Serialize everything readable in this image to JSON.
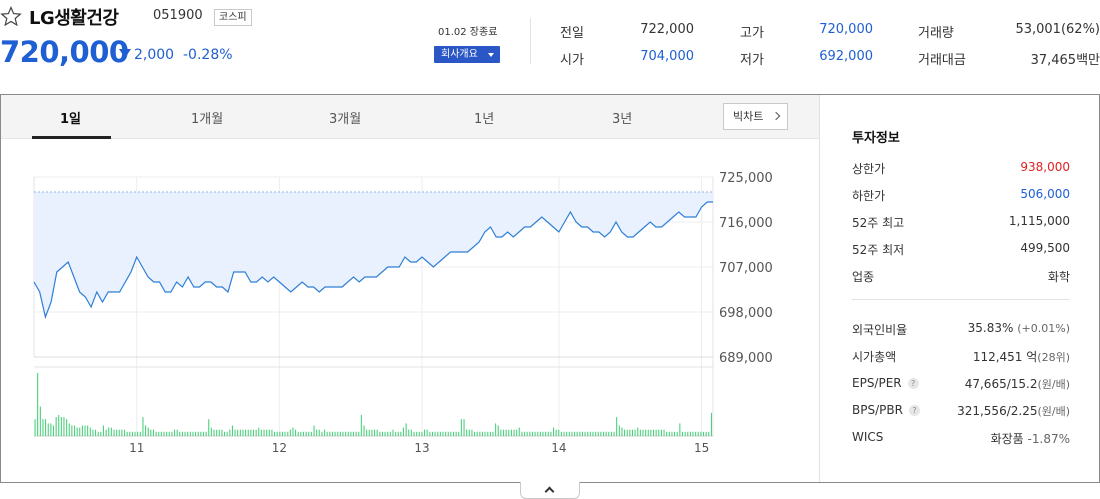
{
  "stock": {
    "name": "LG생활건강",
    "code": "051900",
    "market": "코스피",
    "price": "720,000",
    "change": "2,000",
    "change_pct": "-0.28%",
    "closed_label": "01.02 장종료",
    "company_button": "회사개요"
  },
  "summary": [
    {
      "label": "전일",
      "value": "722,000",
      "color": "#333333"
    },
    {
      "label": "고가",
      "value": "720,000",
      "color": "#1e5fd3"
    },
    {
      "label": "거래량",
      "value": "53,001(62%)",
      "color": "#333333"
    },
    {
      "label": "시가",
      "value": "704,000",
      "color": "#1e5fd3"
    },
    {
      "label": "저가",
      "value": "692,000",
      "color": "#1e5fd3"
    },
    {
      "label": "거래대금",
      "value": "37,465백만",
      "color": "#333333"
    }
  ],
  "tabs": [
    "1일",
    "1개월",
    "3개월",
    "1년",
    "3년"
  ],
  "bigchart_label": "빅차트",
  "chart_data": {
    "type": "line",
    "y_ticks": [
      "725,000",
      "716,000",
      "707,000",
      "698,000",
      "689,000"
    ],
    "y_tick_values": [
      725000,
      716000,
      707000,
      698000,
      689000
    ],
    "ylim": [
      689000,
      725000
    ],
    "prev_close": 722000,
    "x_ticks": [
      "11",
      "12",
      "13",
      "14",
      "15"
    ],
    "x_tick_index": [
      18,
      43,
      68,
      92,
      117
    ],
    "prices": [
      704000,
      702000,
      697000,
      700000,
      706000,
      707000,
      708000,
      705000,
      702000,
      701000,
      699000,
      702000,
      700000,
      702000,
      702000,
      702000,
      704000,
      706000,
      709000,
      707000,
      705000,
      704000,
      704000,
      702000,
      702000,
      704000,
      703000,
      705000,
      703000,
      703000,
      704000,
      704000,
      703000,
      703000,
      702000,
      706000,
      706000,
      706000,
      704000,
      704000,
      705000,
      704000,
      705000,
      704000,
      703000,
      702000,
      703000,
      704000,
      703000,
      703000,
      702000,
      703000,
      703000,
      703000,
      703000,
      704000,
      705000,
      704000,
      705000,
      705000,
      705000,
      706000,
      707000,
      707000,
      707000,
      709000,
      708000,
      708000,
      709000,
      708000,
      707000,
      708000,
      709000,
      710000,
      710000,
      710000,
      710000,
      711000,
      712000,
      714000,
      715000,
      713000,
      713000,
      714000,
      713000,
      714000,
      715000,
      715000,
      716000,
      717000,
      716000,
      715000,
      714000,
      716000,
      718000,
      716000,
      715000,
      715000,
      714000,
      714000,
      713000,
      714000,
      716000,
      714000,
      713000,
      713000,
      714000,
      715000,
      716000,
      715000,
      715000,
      716000,
      717000,
      718000,
      717000,
      717000,
      717000,
      719000,
      720000,
      720000
    ],
    "volumes": [
      8,
      30,
      14,
      8,
      8,
      6,
      6,
      5,
      9,
      10,
      9,
      9,
      8,
      6,
      5,
      5,
      4,
      4,
      5,
      5,
      5,
      4,
      3,
      3,
      2,
      2,
      5,
      3,
      4,
      4,
      3,
      3,
      3,
      3,
      3,
      2,
      2,
      2,
      2,
      2,
      2,
      9,
      5,
      4,
      3,
      3,
      2,
      2,
      2,
      2,
      2,
      2,
      2,
      3,
      3,
      2,
      2,
      2,
      2,
      2,
      2,
      2,
      2,
      2,
      2,
      2,
      8,
      4,
      3,
      3,
      3,
      3,
      2,
      2,
      3,
      5,
      3,
      3,
      3,
      3,
      3,
      3,
      3,
      3,
      3,
      4,
      3,
      3,
      3,
      3,
      3,
      2,
      2,
      2,
      2,
      2,
      2,
      3,
      4,
      3,
      2,
      2,
      2,
      2,
      2,
      2,
      5,
      3,
      3,
      2,
      3,
      2,
      2,
      2,
      2,
      2,
      2,
      2,
      2,
      2,
      2,
      2,
      2,
      2,
      10,
      5,
      3,
      3,
      3,
      3,
      3,
      2,
      2,
      2,
      2,
      2,
      3,
      2,
      2,
      2,
      4,
      6,
      3,
      3,
      2,
      2,
      2,
      2,
      3,
      3,
      2,
      2,
      2,
      2,
      2,
      2,
      2,
      2,
      2,
      2,
      2,
      2,
      8,
      8,
      3,
      3,
      3,
      2,
      2,
      2,
      2,
      2,
      2,
      2,
      2,
      6,
      5,
      3,
      3,
      3,
      3,
      3,
      3,
      3,
      4,
      2,
      2,
      2,
      2,
      2,
      2,
      2,
      2,
      2,
      2,
      2,
      2,
      4,
      3,
      3,
      2,
      2,
      2,
      2,
      2,
      2,
      2,
      2,
      2,
      2,
      2,
      2,
      2,
      2,
      2,
      2,
      2,
      2,
      2,
      2,
      2,
      9,
      5,
      4,
      3,
      3,
      3,
      3,
      3,
      4,
      3,
      3,
      3,
      3,
      3,
      3,
      3,
      3,
      3,
      3,
      2,
      2,
      2,
      2,
      2,
      6,
      2,
      2,
      2,
      2,
      2,
      2,
      2,
      2,
      2,
      2,
      2,
      11
    ]
  },
  "invest": {
    "title": "투자정보",
    "rows1": [
      {
        "label": "상한가",
        "value": "938,000",
        "color": "#e02020"
      },
      {
        "label": "하한가",
        "value": "506,000",
        "color": "#1e5fd3"
      },
      {
        "label": "52주 최고",
        "value": "1,115,000",
        "color": "#333333"
      },
      {
        "label": "52주 최저",
        "value": "499,500",
        "color": "#333333"
      },
      {
        "label": "업종",
        "value": "화학",
        "color": "#333333"
      }
    ],
    "rows2": [
      {
        "label": "외국인비율",
        "value": "35.83%",
        "sub": "(+0.01%)",
        "help": false
      },
      {
        "label": "시가총액",
        "value": "112,451 억",
        "sub": "(28위)",
        "help": false
      },
      {
        "label": "EPS/PER",
        "value": "47,665/15.2",
        "sub": "(원/배)",
        "help": true
      },
      {
        "label": "BPS/PBR",
        "value": "321,556/2.25",
        "sub": "(원/배)",
        "help": true
      },
      {
        "label": "WICS",
        "value": "화장품",
        "sub": "-1.87%",
        "help": false
      }
    ]
  }
}
